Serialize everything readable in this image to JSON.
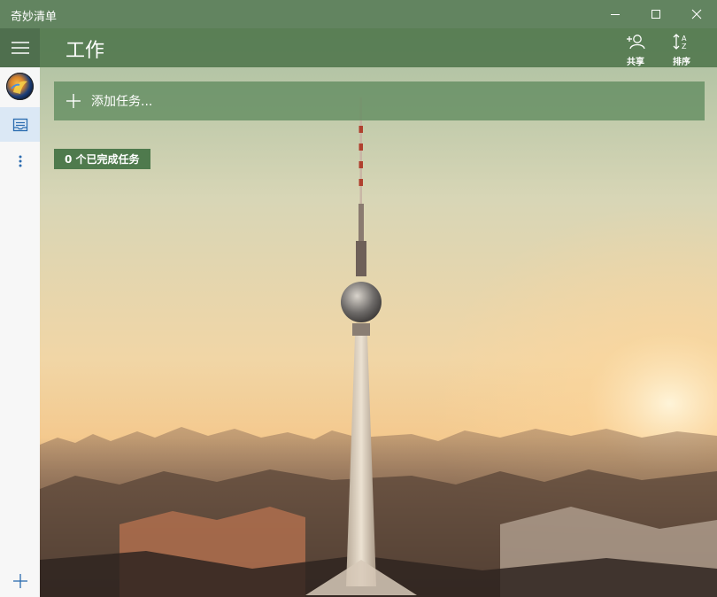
{
  "app": {
    "title": "奇妙清单"
  },
  "window_controls": [
    "minimize-icon",
    "maximize-icon",
    "close-icon"
  ],
  "header": {
    "list_title": "工作",
    "share_label": "共享",
    "sort_label": "排序"
  },
  "add_task": {
    "placeholder": "添加任务..."
  },
  "completed": {
    "label": "0 个已完成任务"
  },
  "colors": {
    "accent": "#628460",
    "rail": "#f7f7f7",
    "selected": "#dbe8f5"
  }
}
